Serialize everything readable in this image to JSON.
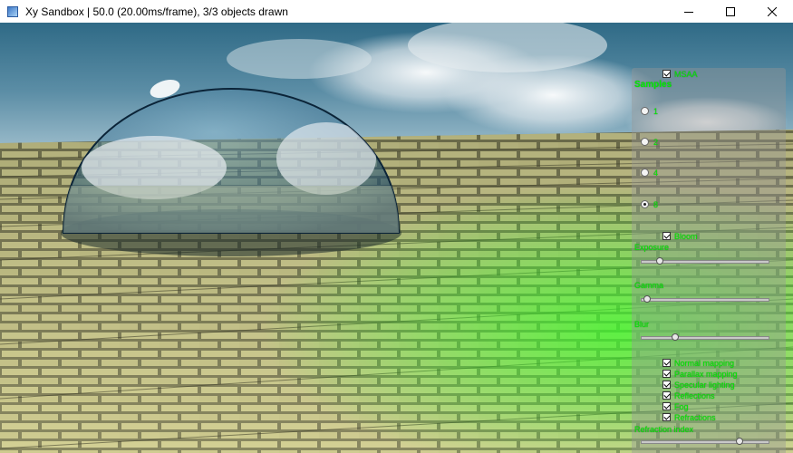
{
  "window": {
    "title": "Xy Sandbox | 50.0 (20.00ms/frame), 3/3 objects drawn",
    "icon": "app-icon",
    "controls": [
      "minimize-icon",
      "maximize-icon",
      "close-icon"
    ]
  },
  "panel": {
    "msaa": {
      "label": "MSAA",
      "checked": true
    },
    "samples": {
      "heading": "Samples",
      "options": [
        {
          "label": "1",
          "selected": false
        },
        {
          "label": "2",
          "selected": false
        },
        {
          "label": "4",
          "selected": false
        },
        {
          "label": "8",
          "selected": true
        }
      ]
    },
    "bloom": {
      "label": "Bloom",
      "checked": true
    },
    "exposure": {
      "label": "Exposure",
      "value": 0.15
    },
    "gamma": {
      "label": "Gamma",
      "value": 0.05
    },
    "blur": {
      "label": "Blur",
      "value": 0.27
    },
    "toggles": [
      {
        "label": "Normal mapping",
        "checked": true
      },
      {
        "label": "Parallax mapping",
        "checked": true
      },
      {
        "label": "Specular lighting",
        "checked": true
      },
      {
        "label": "Reflections",
        "checked": true
      },
      {
        "label": "Fog",
        "checked": true
      },
      {
        "label": "Refractions",
        "checked": true
      }
    ],
    "refraction_index": {
      "label": "Refraction index",
      "value": 0.78
    }
  },
  "colors": {
    "panel_text": "#00ee00",
    "sky": "#4f7f96",
    "brick": "#c7c486",
    "glow": "#39ff2a"
  }
}
